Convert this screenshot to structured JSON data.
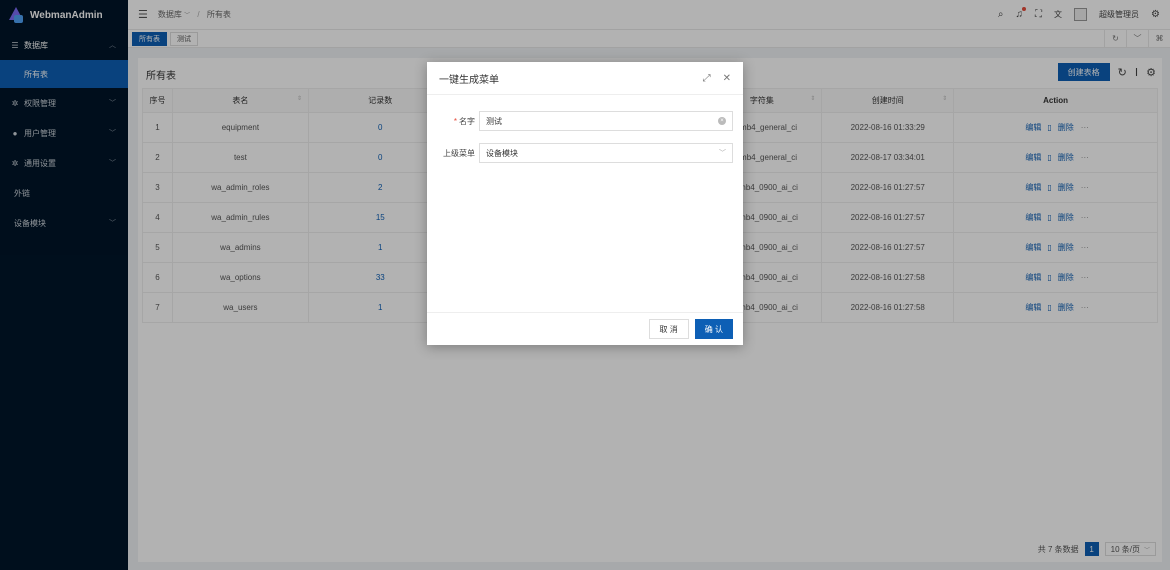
{
  "app": {
    "title": "WebmanAdmin"
  },
  "sidebar": {
    "items": [
      {
        "label": "数据库",
        "icon": "list-icon",
        "open": true,
        "children": [
          {
            "label": "所有表",
            "active": true
          }
        ]
      },
      {
        "label": "权限管理",
        "icon": "gear-icon"
      },
      {
        "label": "用户管理",
        "icon": "user-circle-icon"
      },
      {
        "label": "通用设置",
        "icon": "gear-icon"
      },
      {
        "label": "外链"
      },
      {
        "label": "设备模块"
      }
    ]
  },
  "header": {
    "breadcrumb": [
      "数据库",
      "所有表"
    ],
    "user_name": "超级管理员"
  },
  "tabs": [
    {
      "label": "所有表",
      "active": true
    },
    {
      "label": "测试",
      "active": false
    }
  ],
  "card": {
    "title": "所有表",
    "create_button": "创建表格"
  },
  "table": {
    "columns": [
      "序号",
      "表名",
      "记录数",
      "字符集",
      "创建时间",
      "Action"
    ],
    "rows": [
      {
        "no": "1",
        "name": "equipment",
        "count": "0",
        "charset": "utf8mb4_general_ci",
        "created": "2022-08-16 01:33:29"
      },
      {
        "no": "2",
        "name": "test",
        "count": "0",
        "charset": "utf8mb4_general_ci",
        "created": "2022-08-17 03:34:01"
      },
      {
        "no": "3",
        "name": "wa_admin_roles",
        "count": "2",
        "charset": "utf8mb4_0900_ai_ci",
        "created": "2022-08-16 01:27:57"
      },
      {
        "no": "4",
        "name": "wa_admin_rules",
        "count": "15",
        "charset": "utf8mb4_0900_ai_ci",
        "created": "2022-08-16 01:27:57"
      },
      {
        "no": "5",
        "name": "wa_admins",
        "count": "1",
        "charset": "utf8mb4_0900_ai_ci",
        "created": "2022-08-16 01:27:57"
      },
      {
        "no": "6",
        "name": "wa_options",
        "count": "33",
        "charset": "utf8mb4_0900_ai_ci",
        "created": "2022-08-16 01:27:58"
      },
      {
        "no": "7",
        "name": "wa_users",
        "count": "1",
        "charset": "utf8mb4_0900_ai_ci",
        "created": "2022-08-16 01:27:58"
      }
    ],
    "edit_label": "编辑",
    "delete_label": "删除",
    "more_label": "···"
  },
  "pagination": {
    "total_text": "共 7 条数据",
    "current_page": "1",
    "page_size": "10 条/页"
  },
  "modal": {
    "title": "一键生成菜单",
    "name_label": "名字",
    "name_value": "测试",
    "parent_label": "上级菜单",
    "parent_value": "设备模块",
    "cancel_label": "取 消",
    "confirm_label": "确 认"
  },
  "colors": {
    "primary": "#0d5fb5",
    "sidebar": "#001529"
  }
}
